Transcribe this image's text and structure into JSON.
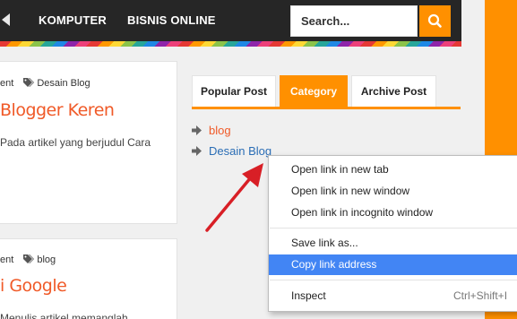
{
  "nav": {
    "items": [
      "KOMPUTER",
      "BISNIS ONLINE"
    ],
    "search_placeholder": "Search..."
  },
  "posts": [
    {
      "meta_left": "ent",
      "tag": "Desain Blog",
      "title": "Blogger Keren",
      "excerpt": "Pada artikel yang berjudul Cara"
    },
    {
      "meta_left": "ent",
      "tag": "blog",
      "title": "i Google",
      "excerpt": "Menulis artikel memanglah"
    }
  ],
  "widget": {
    "tabs": [
      "Popular Post",
      "Category",
      "Archive Post"
    ],
    "active_tab": "Category",
    "categories": [
      "blog",
      "Desain Blog"
    ]
  },
  "context_menu": {
    "items": [
      "Open link in new tab",
      "Open link in new window",
      "Open link in incognito window",
      "Save link as...",
      "Copy link address",
      "Inspect"
    ],
    "highlighted": "Copy link address",
    "inspect_shortcut": "Ctrl+Shift+I"
  },
  "colors": {
    "accent": "#ff9000",
    "nav_bg": "#262626",
    "title_orange": "#f05a28",
    "link_blue": "#2a6db5",
    "menu_highlight": "#4285f4",
    "arrow_red": "#d81f26"
  }
}
